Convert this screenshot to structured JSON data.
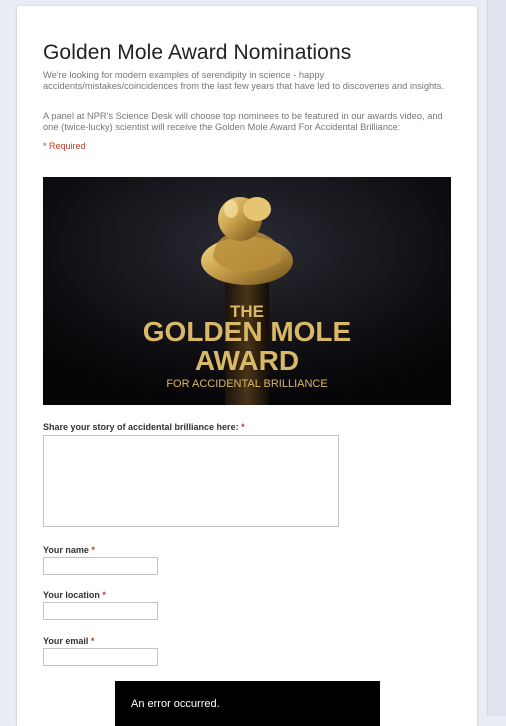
{
  "form": {
    "title": "Golden Mole Award Nominations",
    "description_1": "We're looking for modern examples of serendipity in science - happy accidents/mistakes/coincidences from the last few years that have led to discoveries and insights.",
    "description_2": "A panel at NPR's Science Desk will choose top nominees to be featured in our awards video, and one (twice-lucky) scientist will receive the Golden Mole Award For Accidental Brilliance:",
    "required_note": "* Required"
  },
  "banner": {
    "line1": "THE",
    "line2": "GOLDEN MOLE",
    "line3": "AWARD",
    "line4": "FOR ACCIDENTAL BRILLIANCE"
  },
  "fields": {
    "story_label": "Share your story of accidental brilliance here:",
    "name_label": "Your name",
    "location_label": "Your location",
    "email_label": "Your email",
    "required_marker": "*"
  },
  "toast": {
    "message": "An error occurred."
  },
  "colors": {
    "required": "#c53929",
    "gold": "#c9a14a",
    "page_background": "#e9ecf5"
  }
}
